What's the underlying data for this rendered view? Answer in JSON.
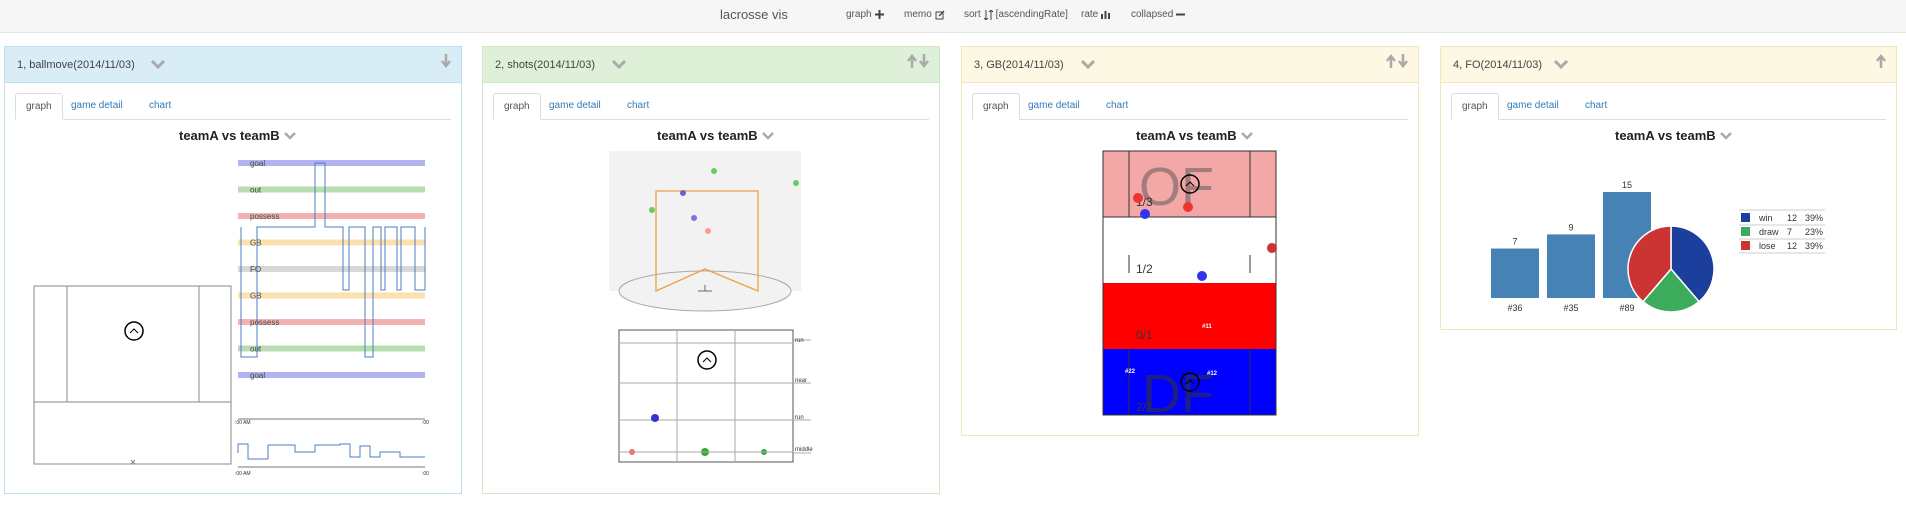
{
  "app": {
    "title": "lacrosse vis"
  },
  "menu": {
    "graph": "graph",
    "memo": "memo",
    "sort": "sort",
    "sort_mode": "[ascendingRate]",
    "rate": "rate",
    "collapsed": "collapsed"
  },
  "tabs": {
    "graph": "graph",
    "game_detail": "game detail",
    "chart": "chart"
  },
  "panels": [
    {
      "title": "1, ballmove(2014/11/03)",
      "matchup": "teamA vs teamB",
      "color": "#d9edf7"
    },
    {
      "title": "2, shots(2014/11/03)",
      "matchup": "teamA vs teamB",
      "color": "#dff0d8"
    },
    {
      "title": "3, GB(2014/11/03)",
      "matchup": "teamA vs teamB",
      "color": "#fcf8e3"
    },
    {
      "title": "4, FO(2014/11/03)",
      "matchup": "teamA vs teamB",
      "color": "#fcf8e3"
    }
  ],
  "ballmove": {
    "rows": [
      "goal",
      "out",
      "possess",
      "GB",
      "FO",
      "GB",
      "possess",
      "out",
      "goal"
    ],
    "row_colors": [
      "#b3b3f0",
      "#b7ddb0",
      "#f3b1b1",
      "#fbe0b0",
      "#d7d7d7",
      "#fbe0b0",
      "#f3b1b1",
      "#b7ddb0",
      "#b3b3f0"
    ],
    "time_start": ":00 AM",
    "time_end": ":00"
  },
  "shots": {
    "zone_labels": [
      "run",
      "near",
      "run",
      "middle"
    ]
  },
  "gb": {
    "of_label": "OF",
    "df_label": "DF",
    "fractions": [
      "1/3",
      "1/2",
      "0/1",
      "2/7"
    ],
    "player_tags": [
      "#11",
      "#22",
      "#12"
    ],
    "zone_colors": [
      "#f4a7a7",
      "#ffffff",
      "#ff0000",
      "#0000ff"
    ]
  },
  "chart_data": [
    {
      "type": "bar",
      "categories": [
        "#36",
        "#35",
        "#89"
      ],
      "values": [
        7,
        9,
        15
      ],
      "color": "#4682b4",
      "ylim": [
        0,
        15
      ]
    },
    {
      "type": "pie",
      "labels": [
        "win",
        "draw",
        "lose"
      ],
      "values": [
        12,
        7,
        12
      ],
      "percents": [
        "39%",
        "23%",
        "39%"
      ],
      "colors": [
        "#1c3f9e",
        "#3cac5c",
        "#cc3333"
      ],
      "legend": "right"
    }
  ]
}
